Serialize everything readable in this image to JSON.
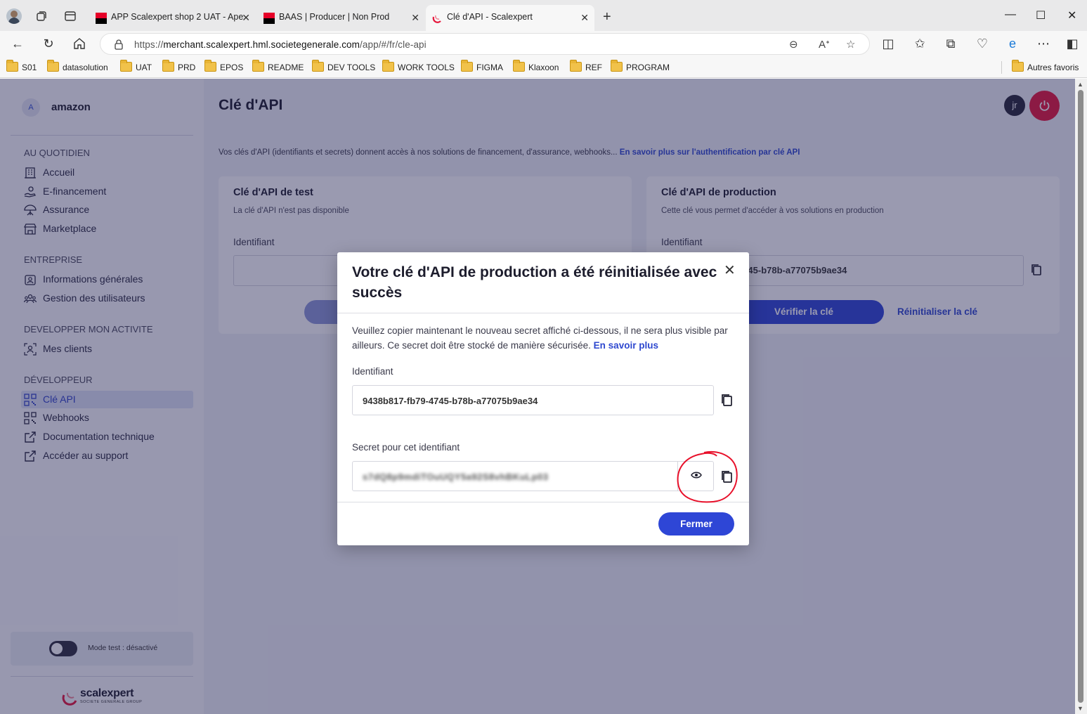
{
  "browser": {
    "tabs": [
      {
        "title": "APP Scalexpert shop 2 UAT - Ape",
        "active": false
      },
      {
        "title": "BAAS | Producer | Non Prod",
        "active": false
      },
      {
        "title": "Clé d'API - Scalexpert",
        "active": true
      }
    ],
    "url_prefix": "https://",
    "url_host": "merchant.scalexpert.hml.societegenerale.com",
    "url_path": "/app/#/fr/cle-api",
    "favorites": [
      "S01",
      "datasolution",
      "UAT",
      "PRD",
      "EPOS",
      "README",
      "DEV TOOLS",
      "WORK TOOLS",
      "FIGMA",
      "Klaxoon",
      "REF",
      "PROGRAM"
    ],
    "other_favorites": "Autres favoris"
  },
  "sidebar": {
    "merchant_initial": "A",
    "merchant_name": "amazon",
    "sections": [
      {
        "title": "AU QUOTIDIEN",
        "items": [
          "Accueil",
          "E-financement",
          "Assurance",
          "Marketplace"
        ]
      },
      {
        "title": "ENTREPRISE",
        "items": [
          "Informations générales",
          "Gestion des utilisateurs"
        ]
      },
      {
        "title": "DEVELOPPER MON ACTIVITE",
        "items": [
          "Mes clients"
        ]
      },
      {
        "title": "DÉVELOPPEUR",
        "items": [
          "Clé API",
          "Webhooks",
          "Documentation technique",
          "Accéder au support"
        ]
      }
    ],
    "active_item": "Clé API",
    "mode_label": "Mode test : désactivé",
    "logo_name": "scalexpert",
    "logo_sub": "SOCIETE GENERALE GROUP"
  },
  "main": {
    "title": "Clé d'API",
    "user_initials": "jr",
    "intro_text": "Vos clés d'API (identifiants et secrets) donnent accès à nos solutions de financement, d'assurance, webhooks...",
    "intro_link": "En savoir plus sur l'authentification par clé API",
    "test_card": {
      "title": "Clé d'API de test",
      "subtitle": "La clé d'API n'est pas disponible",
      "label": "Identifiant"
    },
    "prod_card": {
      "title": "Clé d'API de production",
      "subtitle": "Cette clé vous permet d'accéder à vos solutions en production",
      "label": "Identifiant",
      "value": "9438b817-fb79-4745-b78b-a77075b9ae34",
      "verify_label": "Vérifier la clé",
      "reset_label": "Réinitialiser la clé"
    }
  },
  "modal": {
    "title": "Votre clé d'API de production a été réinitialisée avec succès",
    "text": "Veuillez copier maintenant le nouveau secret affiché ci-dessous, il ne sera plus visible par ailleurs. Ce secret doit être stocké de manière sécurisée.",
    "link": "En savoir plus",
    "id_label": "Identifiant",
    "id_value": "9438b817-fb79-4745-b78b-a77075b9ae34",
    "secret_label": "Secret pour cet identifiant",
    "secret_value": "s7dQ8p9mdiTOuUQY5a92S8vhBKuLp03",
    "close_label": "Fermer"
  },
  "colors": {
    "accent": "#2e46d6",
    "power": "#e6163b",
    "annotation": "#e8102a"
  }
}
